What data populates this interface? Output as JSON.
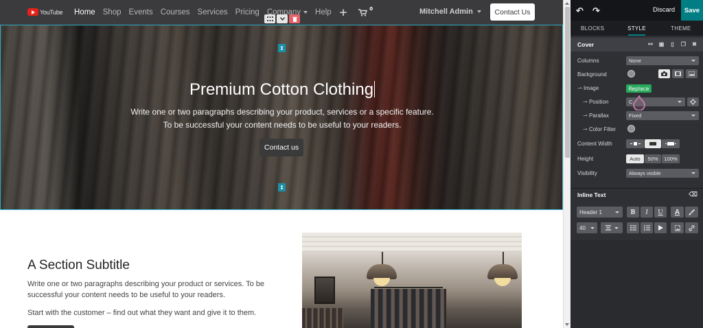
{
  "site": {
    "logo_text": "YouTube",
    "nav": {
      "items": [
        "Home",
        "Shop",
        "Events",
        "Courses",
        "Services",
        "Pricing",
        "Company",
        "Help"
      ],
      "cart_count": "0",
      "user_name": "Mitchell Admin",
      "cta_label": "Contact Us"
    },
    "cover": {
      "title": "Premium Cotton Clothing",
      "line1": "Write one or two paragraphs describing your product, services or a specific feature.",
      "line2": "To be successful your content needs to be useful to your readers.",
      "button_label": "Contact us"
    },
    "section": {
      "subtitle": "A Section Subtitle",
      "p1_line1": "Write one or two paragraphs describing your product or services. To be",
      "p1_line2": "successful your content needs to be useful to your readers.",
      "p2": "Start with the customer – find out what they want and give it to them."
    }
  },
  "panel": {
    "discard_label": "Discard",
    "save_label": "Save",
    "tabs": [
      "BLOCKS",
      "STYLE",
      "THEME"
    ],
    "active_tab": "STYLE",
    "accent_color": "#017e84",
    "cover_title": "Cover",
    "rows": {
      "columns_label": "Columns",
      "columns_value": "None",
      "background_label": "Background",
      "image_label": "Image",
      "replace_label": "Replace",
      "position_label": "Position",
      "position_value": "C",
      "parallax_label": "Parallax",
      "parallax_value": "Fixed",
      "color_filter_label": "Color Filter",
      "content_width_label": "Content Width",
      "height_label": "Height",
      "height_options": [
        "Auto",
        "50%",
        "100%"
      ],
      "height_selected": "Auto",
      "visibility_label": "Visibility",
      "visibility_value": "Always visible"
    },
    "inline_text": {
      "title": "Inline Text",
      "style_value": "Header 1",
      "bold": "B",
      "italic": "I",
      "underline": "U",
      "font_color": "A",
      "font_size": "40"
    }
  }
}
